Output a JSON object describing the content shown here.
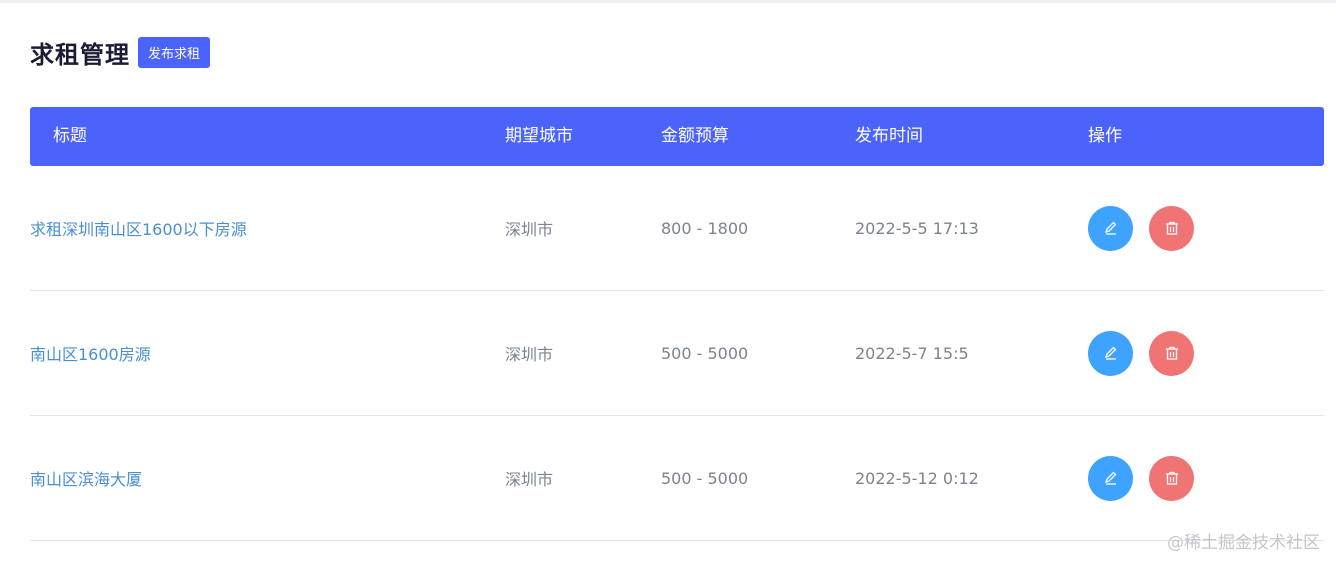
{
  "header": {
    "title": "求租管理",
    "publish_button": "发布求租"
  },
  "table": {
    "columns": [
      "标题",
      "期望城市",
      "金额预算",
      "发布时间",
      "操作"
    ],
    "rows": [
      {
        "title": "求租深圳南山区1600以下房源",
        "city": "深圳市",
        "budget": "800 - 1800",
        "time": "2022-5-5 17:13"
      },
      {
        "title": "南山区1600房源",
        "city": "深圳市",
        "budget": "500 - 5000",
        "time": "2022-5-7 15:5"
      },
      {
        "title": "南山区滨海大厦",
        "city": "深圳市",
        "budget": "500 - 5000",
        "time": "2022-5-12 0:12"
      }
    ]
  },
  "watermark": "@稀土掘金技术社区",
  "icons": {
    "edit": "pencil-icon",
    "delete": "trash-icon"
  },
  "colors": {
    "primary": "#4b63fb",
    "edit": "#3ea2ff",
    "delete": "#f07474",
    "link": "#4a8fd0"
  }
}
